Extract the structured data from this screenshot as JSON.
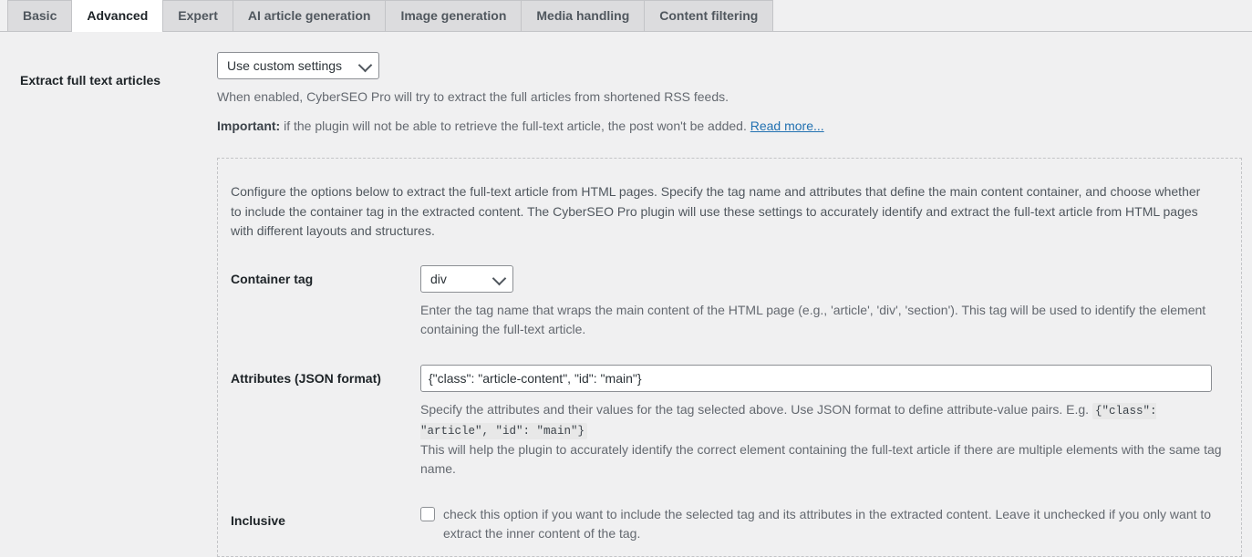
{
  "tabs": [
    {
      "label": "Basic",
      "active": false
    },
    {
      "label": "Advanced",
      "active": true
    },
    {
      "label": "Expert",
      "active": false
    },
    {
      "label": "AI article generation",
      "active": false
    },
    {
      "label": "Image generation",
      "active": false
    },
    {
      "label": "Media handling",
      "active": false
    },
    {
      "label": "Content filtering",
      "active": false
    }
  ],
  "extract": {
    "label": "Extract full text articles",
    "select_value": "Use custom settings",
    "select_options": [
      "Use custom settings"
    ],
    "desc_1": "When enabled, CyberSEO Pro will try to extract the full articles from shortened RSS feeds.",
    "desc_2_strong": "Important:",
    "desc_2_text": " if the plugin will not be able to retrieve the full-text article, the post won't be added. ",
    "read_more_label": "Read more..."
  },
  "panel": {
    "intro": "Configure the options below to extract the full-text article from HTML pages. Specify the tag name and attributes that define the main content container, and choose whether to include the container tag in the extracted content. The CyberSEO Pro plugin will use these settings to accurately identify and extract the full-text article from HTML pages with different layouts and structures.",
    "container_tag": {
      "label": "Container tag",
      "select_value": "div",
      "select_options": [
        "div"
      ],
      "desc": "Enter the tag name that wraps the main content of the HTML page (e.g., 'article', 'div', 'section'). This tag will be used to identify the element containing the full-text article."
    },
    "attributes": {
      "label": "Attributes (JSON format)",
      "value": "{\"class\": \"article-content\", \"id\": \"main\"}",
      "placeholder": "",
      "desc_before_code": "Specify the attributes and their values for the tag selected above. Use JSON format to define attribute-value pairs. E.g. ",
      "code_example": "{\"class\": \"article\", \"id\": \"main\"}",
      "desc_after": "This will help the plugin to accurately identify the correct element containing the full-text article if there are multiple elements with the same tag name."
    },
    "inclusive": {
      "label": "Inclusive",
      "checked": false,
      "desc": "check this option if you want to include the selected tag and its attributes in the extracted content. Leave it unchecked if you only want to extract the inner content of the tag."
    }
  },
  "colors": {
    "page_background": "#f0f0f1",
    "tab_inactive": "#dcdcde",
    "tab_active": "#ffffff",
    "border": "#c3c4c7",
    "link": "#2271b1",
    "label_text": "#1d2327",
    "help_text": "#646970",
    "code_background": "#e8e8e8"
  },
  "icons": {
    "chevron_down": "chevron-down-icon"
  }
}
